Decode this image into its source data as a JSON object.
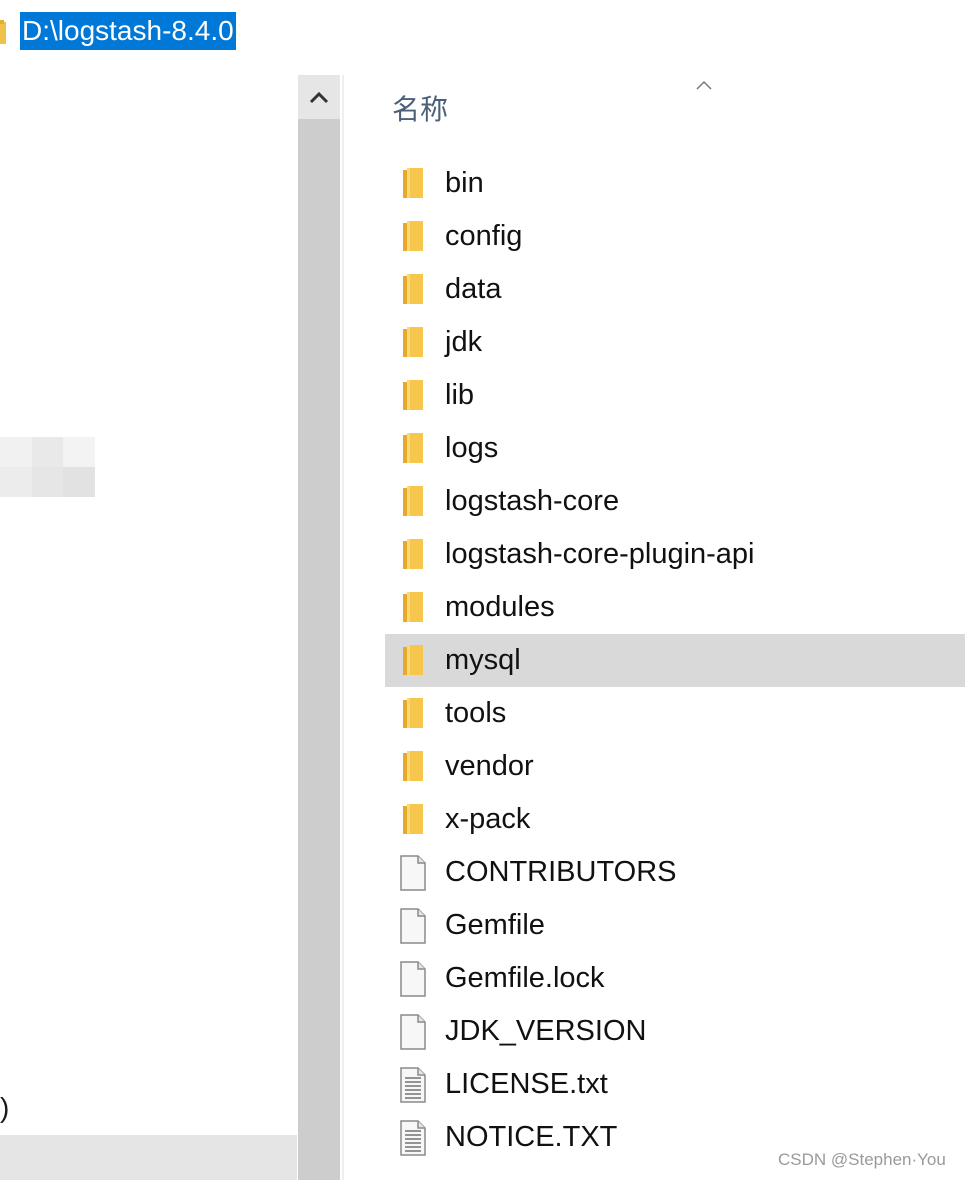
{
  "address_bar": {
    "path": "D:\\logstash-8.4.0"
  },
  "nav_pane": {
    "partial_text": ")"
  },
  "header": {
    "name_label": "名称"
  },
  "files": [
    {
      "name": "bin",
      "type": "folder"
    },
    {
      "name": "config",
      "type": "folder"
    },
    {
      "name": "data",
      "type": "folder"
    },
    {
      "name": "jdk",
      "type": "folder"
    },
    {
      "name": "lib",
      "type": "folder"
    },
    {
      "name": "logs",
      "type": "folder"
    },
    {
      "name": "logstash-core",
      "type": "folder"
    },
    {
      "name": "logstash-core-plugin-api",
      "type": "folder"
    },
    {
      "name": "modules",
      "type": "folder"
    },
    {
      "name": "mysql",
      "type": "folder",
      "selected": true
    },
    {
      "name": "tools",
      "type": "folder"
    },
    {
      "name": "vendor",
      "type": "folder"
    },
    {
      "name": "x-pack",
      "type": "folder"
    },
    {
      "name": "CONTRIBUTORS",
      "type": "file"
    },
    {
      "name": "Gemfile",
      "type": "file"
    },
    {
      "name": "Gemfile.lock",
      "type": "file"
    },
    {
      "name": "JDK_VERSION",
      "type": "file"
    },
    {
      "name": "LICENSE.txt",
      "type": "text-file"
    },
    {
      "name": "NOTICE.TXT",
      "type": "text-file"
    }
  ],
  "watermark": "CSDN @Stephen·You",
  "colors": {
    "selection": "#0078d7",
    "row_hover": "#d9d9d9",
    "folder": "#f5c04a"
  }
}
